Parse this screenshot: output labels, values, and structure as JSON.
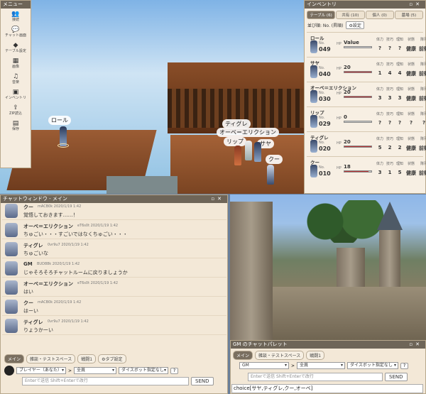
{
  "menu": {
    "title": "メニュー",
    "items": [
      {
        "label": "接続",
        "icon": "people-icon"
      },
      {
        "label": "チャット画面",
        "icon": "chat-icon"
      },
      {
        "label": "テーブル設定",
        "icon": "layers-icon"
      },
      {
        "label": "画像",
        "icon": "photo-library-icon"
      },
      {
        "label": "音楽",
        "icon": "music-queue-icon"
      },
      {
        "label": "インベントリ",
        "icon": "inventory-icon"
      },
      {
        "label": "ZIP読込",
        "icon": "zip-load-icon"
      },
      {
        "label": "保存",
        "icon": "save-icon"
      }
    ]
  },
  "scene": {
    "nameplates": [
      "ロール",
      "ティグレ",
      "オーベ＝エリクション",
      "リップ",
      "サヤ",
      "クー"
    ]
  },
  "inventory": {
    "title": "インベントリ",
    "tabs": [
      "テーブル (6)",
      "共有 (10)",
      "個人 (0)",
      "墓場 (5)"
    ],
    "sort_label": "並び順: No. (昇順)",
    "settings_label": "設定",
    "characters": [
      {
        "name": "ロール",
        "no": "049",
        "hp_label": "HP",
        "hp": "Value",
        "hp_pct": 0,
        "stats": [
          "?",
          "?",
          "?"
        ],
        "status": "健康",
        "row": "前衛",
        "hp_text": "HP Value"
      },
      {
        "name": "サヤ",
        "no": "040",
        "hp_label": "HP",
        "hp": "20",
        "hp_pct": 100,
        "stats": [
          "1",
          "4",
          "4"
        ],
        "status": "健康",
        "row": "前衛"
      },
      {
        "name": "オーベ＝エリクション",
        "no": "030",
        "hp_label": "HP",
        "hp": "20",
        "hp_pct": 100,
        "stats": [
          "3",
          "3",
          "3"
        ],
        "status": "健康",
        "row": "前衛"
      },
      {
        "name": "リップ",
        "no": "029",
        "hp_label": "HP",
        "hp": "0",
        "hp_pct": 0,
        "stats": [
          "?",
          "?",
          "?"
        ],
        "status": "?",
        "row": "?"
      },
      {
        "name": "ティグレ",
        "no": "020",
        "hp_label": "HP",
        "hp": "20",
        "hp_pct": 100,
        "stats": [
          "5",
          "2",
          "2"
        ],
        "status": "健康",
        "row": "前衛"
      },
      {
        "name": "クー",
        "no": "010",
        "hp_label": "HP",
        "hp": "18",
        "hp_pct": 90,
        "stats": [
          "3",
          "1",
          "5"
        ],
        "status": "健康",
        "row": "前衛"
      }
    ],
    "col_labels": [
      "体力",
      "技巧",
      "理知",
      "状態",
      "隊列"
    ],
    "no_label": "No."
  },
  "chat": {
    "title": "チャットウィンドウ - メイン",
    "messages": [
      {
        "who": "クー",
        "meta": "mACB0k 2020/1/19 1:42",
        "text": "覚悟しておきます……！"
      },
      {
        "who": "オーベ＝エリクション",
        "meta": "eT6s0t 2020/1/19 1:42",
        "text": "ちゅごい・・・すごいではなくちゅごい・・・"
      },
      {
        "who": "ティグレ",
        "meta": "0vr9u7 2020/1/19 1:42",
        "text": "ちゅごいな"
      },
      {
        "who": "GM",
        "meta": "BUD88k 2020/1/19 1:42",
        "text": "じゃそろそろチャットルームに戻りましょうか"
      },
      {
        "who": "オーベ＝エリクション",
        "meta": "eT6s0t 2020/1/19 1:42",
        "text": "はい"
      },
      {
        "who": "クー",
        "meta": "mACB0k 2020/1/19 1:42",
        "text": "はーい"
      },
      {
        "who": "ティグレ",
        "meta": "0vr9u7 2020/1/19 1:42",
        "text": "りょうかーい"
      }
    ],
    "tabs": [
      "メイン",
      "雑談・テストスペース",
      "戦闘1"
    ],
    "tab_settings": "タブ設定",
    "sender": "プレイヤー（あなた）",
    "arrow": ">",
    "target": "全員",
    "dice": "ダイスボット指定なし",
    "help": "?",
    "placeholder": "Enterで送信  Shift+Enterで改行",
    "send": "SEND"
  },
  "palette": {
    "title": "GM のチャットパレット",
    "tabs": [
      "メイン",
      "雑談・テストスペース",
      "戦闘1"
    ],
    "sender": "GM",
    "arrow": ">",
    "target": "全員",
    "dice": "ダイスボット指定なし",
    "help": "?",
    "placeholder": "Enterで送信  Shift+Enterで改行",
    "send": "SEND",
    "entry": "choice[サヤ,ティグレ,クー,オーベ]"
  }
}
